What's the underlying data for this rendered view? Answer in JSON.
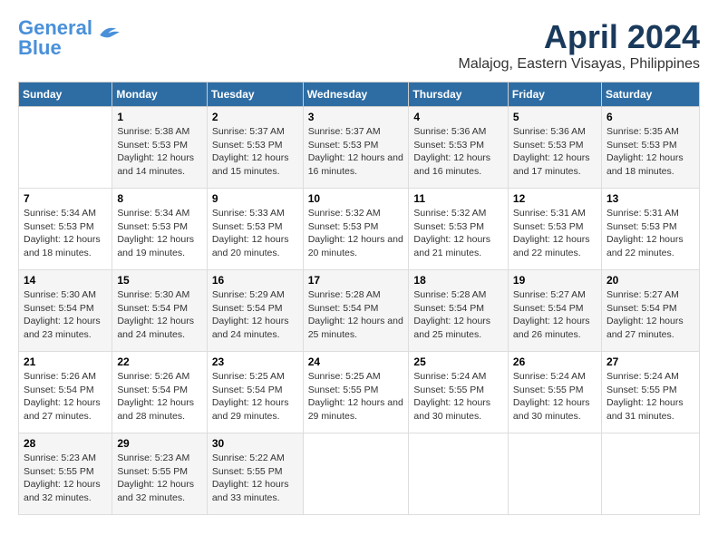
{
  "header": {
    "logo_line1": "General",
    "logo_line2": "Blue",
    "month": "April 2024",
    "location": "Malajog, Eastern Visayas, Philippines"
  },
  "weekdays": [
    "Sunday",
    "Monday",
    "Tuesday",
    "Wednesday",
    "Thursday",
    "Friday",
    "Saturday"
  ],
  "weeks": [
    [
      {
        "day": "",
        "sunrise": "",
        "sunset": "",
        "daylight": ""
      },
      {
        "day": "1",
        "sunrise": "5:38 AM",
        "sunset": "5:53 PM",
        "daylight": "12 hours and 14 minutes."
      },
      {
        "day": "2",
        "sunrise": "5:37 AM",
        "sunset": "5:53 PM",
        "daylight": "12 hours and 15 minutes."
      },
      {
        "day": "3",
        "sunrise": "5:37 AM",
        "sunset": "5:53 PM",
        "daylight": "12 hours and 16 minutes."
      },
      {
        "day": "4",
        "sunrise": "5:36 AM",
        "sunset": "5:53 PM",
        "daylight": "12 hours and 16 minutes."
      },
      {
        "day": "5",
        "sunrise": "5:36 AM",
        "sunset": "5:53 PM",
        "daylight": "12 hours and 17 minutes."
      },
      {
        "day": "6",
        "sunrise": "5:35 AM",
        "sunset": "5:53 PM",
        "daylight": "12 hours and 18 minutes."
      }
    ],
    [
      {
        "day": "7",
        "sunrise": "5:34 AM",
        "sunset": "5:53 PM",
        "daylight": "12 hours and 18 minutes."
      },
      {
        "day": "8",
        "sunrise": "5:34 AM",
        "sunset": "5:53 PM",
        "daylight": "12 hours and 19 minutes."
      },
      {
        "day": "9",
        "sunrise": "5:33 AM",
        "sunset": "5:53 PM",
        "daylight": "12 hours and 20 minutes."
      },
      {
        "day": "10",
        "sunrise": "5:32 AM",
        "sunset": "5:53 PM",
        "daylight": "12 hours and 20 minutes."
      },
      {
        "day": "11",
        "sunrise": "5:32 AM",
        "sunset": "5:53 PM",
        "daylight": "12 hours and 21 minutes."
      },
      {
        "day": "12",
        "sunrise": "5:31 AM",
        "sunset": "5:53 PM",
        "daylight": "12 hours and 22 minutes."
      },
      {
        "day": "13",
        "sunrise": "5:31 AM",
        "sunset": "5:53 PM",
        "daylight": "12 hours and 22 minutes."
      }
    ],
    [
      {
        "day": "14",
        "sunrise": "5:30 AM",
        "sunset": "5:54 PM",
        "daylight": "12 hours and 23 minutes."
      },
      {
        "day": "15",
        "sunrise": "5:30 AM",
        "sunset": "5:54 PM",
        "daylight": "12 hours and 24 minutes."
      },
      {
        "day": "16",
        "sunrise": "5:29 AM",
        "sunset": "5:54 PM",
        "daylight": "12 hours and 24 minutes."
      },
      {
        "day": "17",
        "sunrise": "5:28 AM",
        "sunset": "5:54 PM",
        "daylight": "12 hours and 25 minutes."
      },
      {
        "day": "18",
        "sunrise": "5:28 AM",
        "sunset": "5:54 PM",
        "daylight": "12 hours and 25 minutes."
      },
      {
        "day": "19",
        "sunrise": "5:27 AM",
        "sunset": "5:54 PM",
        "daylight": "12 hours and 26 minutes."
      },
      {
        "day": "20",
        "sunrise": "5:27 AM",
        "sunset": "5:54 PM",
        "daylight": "12 hours and 27 minutes."
      }
    ],
    [
      {
        "day": "21",
        "sunrise": "5:26 AM",
        "sunset": "5:54 PM",
        "daylight": "12 hours and 27 minutes."
      },
      {
        "day": "22",
        "sunrise": "5:26 AM",
        "sunset": "5:54 PM",
        "daylight": "12 hours and 28 minutes."
      },
      {
        "day": "23",
        "sunrise": "5:25 AM",
        "sunset": "5:54 PM",
        "daylight": "12 hours and 29 minutes."
      },
      {
        "day": "24",
        "sunrise": "5:25 AM",
        "sunset": "5:55 PM",
        "daylight": "12 hours and 29 minutes."
      },
      {
        "day": "25",
        "sunrise": "5:24 AM",
        "sunset": "5:55 PM",
        "daylight": "12 hours and 30 minutes."
      },
      {
        "day": "26",
        "sunrise": "5:24 AM",
        "sunset": "5:55 PM",
        "daylight": "12 hours and 30 minutes."
      },
      {
        "day": "27",
        "sunrise": "5:24 AM",
        "sunset": "5:55 PM",
        "daylight": "12 hours and 31 minutes."
      }
    ],
    [
      {
        "day": "28",
        "sunrise": "5:23 AM",
        "sunset": "5:55 PM",
        "daylight": "12 hours and 32 minutes."
      },
      {
        "day": "29",
        "sunrise": "5:23 AM",
        "sunset": "5:55 PM",
        "daylight": "12 hours and 32 minutes."
      },
      {
        "day": "30",
        "sunrise": "5:22 AM",
        "sunset": "5:55 PM",
        "daylight": "12 hours and 33 minutes."
      },
      {
        "day": "",
        "sunrise": "",
        "sunset": "",
        "daylight": ""
      },
      {
        "day": "",
        "sunrise": "",
        "sunset": "",
        "daylight": ""
      },
      {
        "day": "",
        "sunrise": "",
        "sunset": "",
        "daylight": ""
      },
      {
        "day": "",
        "sunrise": "",
        "sunset": "",
        "daylight": ""
      }
    ]
  ],
  "sunrise_label": "Sunrise:",
  "sunset_label": "Sunset:",
  "daylight_label": "Daylight:"
}
